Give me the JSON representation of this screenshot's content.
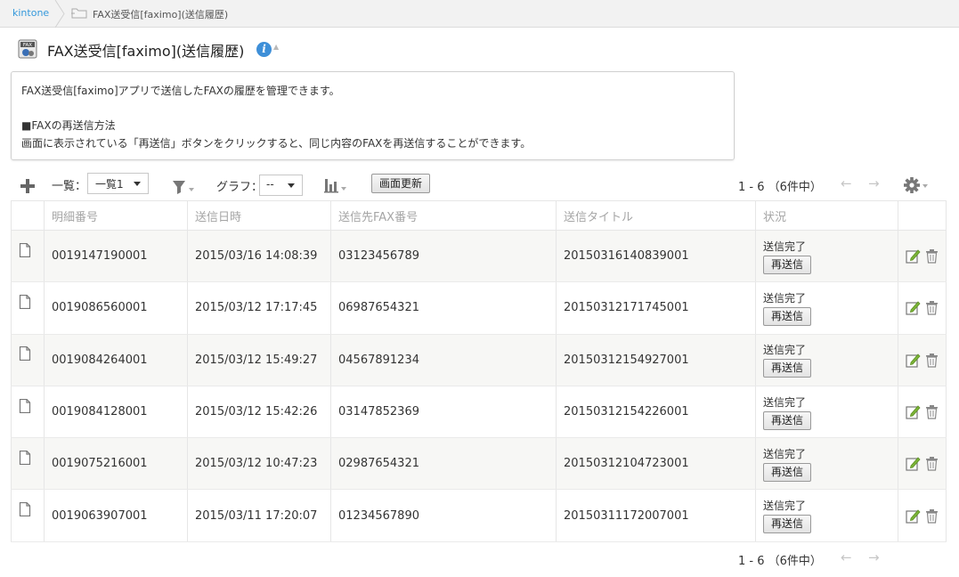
{
  "breadcrumb": {
    "home": "kintone",
    "current": "FAX送受信[faximo](送信履歴)"
  },
  "app": {
    "title": "FAX送受信[faximo](送信履歴)",
    "icon_text": "FAX"
  },
  "description": {
    "line1": "FAX送受信[faximo]アプリで送信したFAXの履歴を管理できます。",
    "line2": "■FAXの再送信方法",
    "line3": "画面に表示されている「再送信」ボタンをクリックすると、同じ内容のFAXを再送信することができます。"
  },
  "toolbar": {
    "view_label": "一覧：",
    "view_value": "一覧1",
    "graph_label": "グラフ：",
    "graph_value": "--",
    "refresh_label": "画面更新",
    "pager_text": "1 - 6 （6件中）"
  },
  "table": {
    "headers": [
      "明細番号",
      "送信日時",
      "送信先FAX番号",
      "送信タイトル",
      "状況"
    ],
    "rows": [
      {
        "id": "0019147190001",
        "datetime": "2015/03/16 14:08:39",
        "fax": "03123456789",
        "title": "20150316140839001",
        "status": "送信完了",
        "resend": "再送信"
      },
      {
        "id": "0019086560001",
        "datetime": "2015/03/12 17:17:45",
        "fax": "06987654321",
        "title": "20150312171745001",
        "status": "送信完了",
        "resend": "再送信"
      },
      {
        "id": "0019084264001",
        "datetime": "2015/03/12 15:49:27",
        "fax": "04567891234",
        "title": "20150312154927001",
        "status": "送信完了",
        "resend": "再送信"
      },
      {
        "id": "0019084128001",
        "datetime": "2015/03/12 15:42:26",
        "fax": "03147852369",
        "title": "20150312154226001",
        "status": "送信完了",
        "resend": "再送信"
      },
      {
        "id": "0019075216001",
        "datetime": "2015/03/12 10:47:23",
        "fax": "02987654321",
        "title": "20150312104723001",
        "status": "送信完了",
        "resend": "再送信"
      },
      {
        "id": "0019063907001",
        "datetime": "2015/03/11 17:20:07",
        "fax": "01234567890",
        "title": "20150311172007001",
        "status": "送信完了",
        "resend": "再送信"
      }
    ]
  },
  "colors": {
    "link": "#3498db",
    "info": "#3e8fd8",
    "edit": "#7bb437"
  },
  "icons": [
    "folder-icon",
    "app-icon",
    "info-icon",
    "add-icon",
    "filter-icon",
    "chart-icon",
    "prev-icon",
    "next-icon",
    "gear-icon",
    "document-icon",
    "edit-icon",
    "trash-icon"
  ]
}
